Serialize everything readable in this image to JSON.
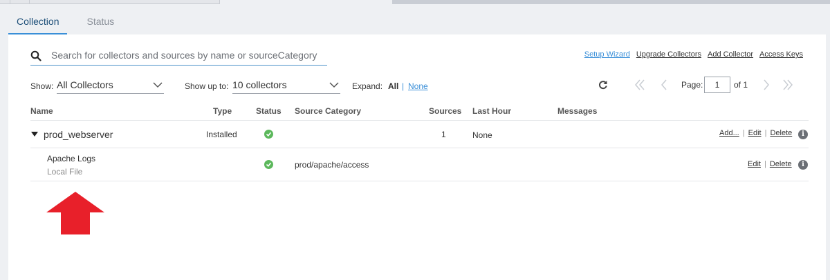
{
  "tabs": [
    {
      "label": "Collection",
      "active": true
    },
    {
      "label": "Status",
      "active": false
    }
  ],
  "search": {
    "placeholder": "Search for collectors and sources by name or sourceCategory",
    "icon": "search-icon"
  },
  "toplinks": {
    "setup_wizard": "Setup Wizard",
    "upgrade_collectors": "Upgrade Collectors",
    "add_collector": "Add Collector",
    "access_keys": "Access Keys"
  },
  "filters": {
    "show_label": "Show:",
    "show_value": "All Collectors",
    "show_up_to_label": "Show up to:",
    "show_up_to_value": "10 collectors",
    "expand_label": "Expand:",
    "expand_all": "All",
    "expand_sep": "|",
    "expand_none": "None"
  },
  "pager": {
    "page_label": "Page:",
    "page_value": "1",
    "of_label": "of 1"
  },
  "table": {
    "columns": {
      "name": "Name",
      "type": "Type",
      "status": "Status",
      "source_category": "Source Category",
      "sources": "Sources",
      "last_hour": "Last Hour",
      "messages": "Messages"
    },
    "collector": {
      "name": "prod_webserver",
      "type": "Installed",
      "status": "ok",
      "sources": "1",
      "last_hour": "None",
      "actions": {
        "add": "Add...",
        "edit": "Edit",
        "delete": "Delete",
        "sep": "|"
      }
    },
    "source": {
      "name": "Apache Logs",
      "subtype": "Local File",
      "status": "ok",
      "source_category": "prod/apache/access",
      "actions": {
        "edit": "Edit",
        "delete": "Delete",
        "sep": "|"
      }
    }
  },
  "colors": {
    "accent": "#3a8fd8",
    "status_ok": "#5cb85c",
    "annotation_arrow": "#e8202a"
  }
}
